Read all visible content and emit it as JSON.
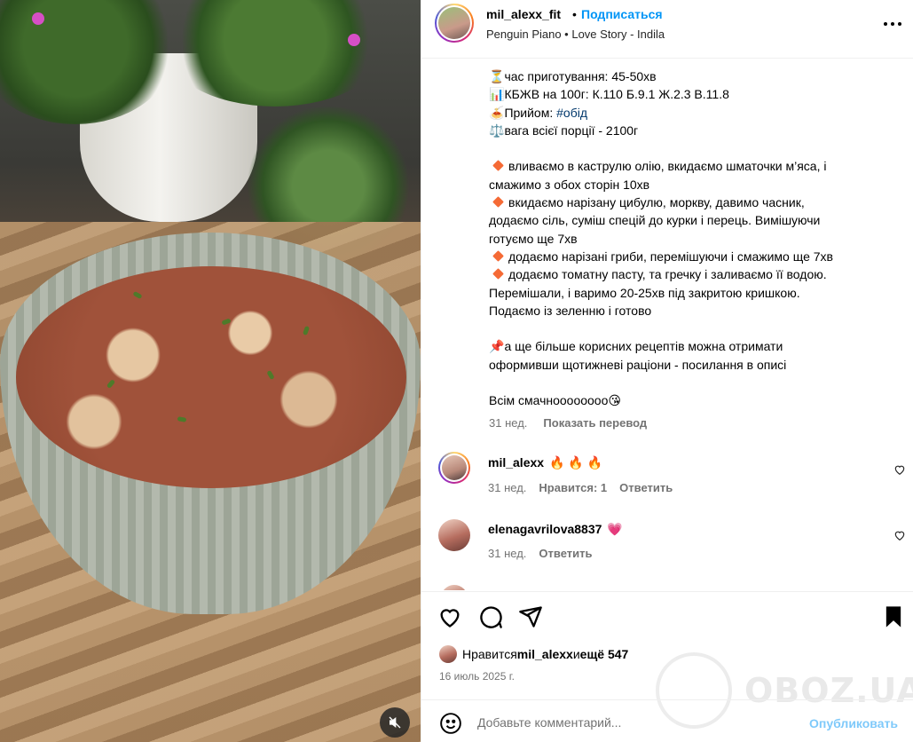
{
  "header": {
    "username": "mil_alexx_fit",
    "dot": "•",
    "follow_label": "Подписаться",
    "music": "Penguin Piano • Love Story - Indila"
  },
  "caption": {
    "lines": [
      {
        "icon": "⏳",
        "text": "час приготування: 45-50хв"
      },
      {
        "icon": "📊",
        "text": "КБЖВ на 100г: К.110 Б.9.1 Ж.2.3 В.11.8"
      },
      {
        "icon": "🍝",
        "text": "Прийом: ",
        "tag": "#обід"
      },
      {
        "icon": "⚖️",
        "text": "вага всієї порції - 2100г"
      }
    ],
    "steps": [
      [
        "вливаємо в каструлю олію, вкидаємо шматочки м’яса, і",
        "смажимо з обох сторін 10хв"
      ],
      [
        "вкидаємо нарізану цибулю, моркву, давимо часник,",
        "додаємо сіль, суміш спецій до курки і перець. Вимішуючи",
        "готуємо ще 7хв"
      ],
      [
        "додаємо нарізані гриби, перемішуючи і смажимо ще 7хв"
      ],
      [
        "додаємо томатну пасту, та гречку і заливаємо її водою.",
        "Перемішали, і варимо 20-25хв під закритою кришкою.",
        "Подаємо із зеленню і готово"
      ]
    ],
    "promo_icon": "📌",
    "promo": [
      "а ще більше корисних рецептів можна отримати",
      "оформивши щотижневі раціони - посилання в описі"
    ],
    "closing": "Всім смачноооооооо😘",
    "age": "31 нед.",
    "translate_label": "Показать перевод"
  },
  "comments": [
    {
      "user": "mil_alexx",
      "text": "🔥 🔥 🔥",
      "age": "31 нед.",
      "likes": "Нравится: 1",
      "reply": "Ответить"
    },
    {
      "user": "elenagavrilova8837",
      "text": "💗",
      "age": "31 нед.",
      "reply": "Ответить"
    }
  ],
  "likes": {
    "prefix": "Нравится ",
    "user": "mil_alexx",
    "middle": " и ",
    "more": "ещё 547"
  },
  "date": "16 июль 2025 г.",
  "add_comment": {
    "placeholder": "Добавьте комментарий...",
    "post_label": "Опубликовать"
  },
  "watermark": "OBOZ.UA",
  "colors": {
    "accent": "#0095f6",
    "muted": "#737373",
    "bullet": "#f56a35"
  }
}
